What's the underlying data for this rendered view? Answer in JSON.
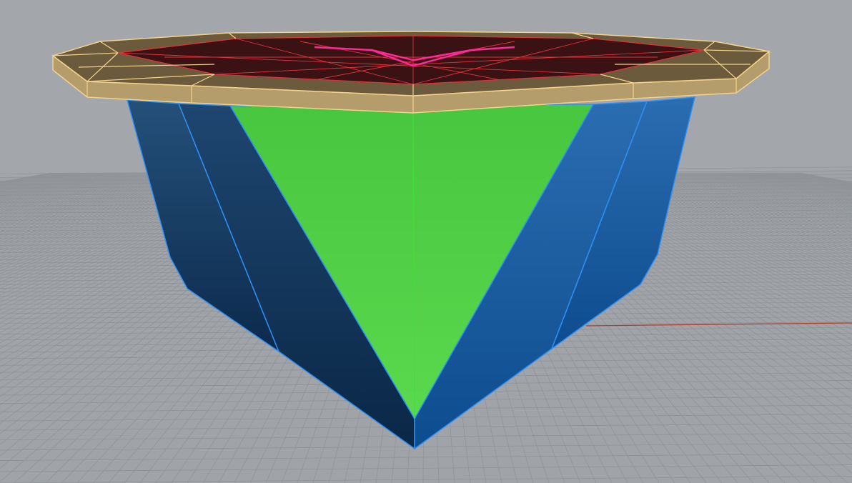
{
  "viewport": {
    "view": "perspective",
    "background_color": "#a3a7ac",
    "grid_color": "#9c9fa3",
    "grid_line_color": "#8e9296",
    "x_axis_color": "#b03a2e",
    "model": {
      "parts": [
        {
          "name": "top-slab",
          "color": "#c8ad78",
          "edge_color": "#f3d28b",
          "selected": true
        },
        {
          "name": "recessed-top-surface",
          "color": "#3a1214",
          "edge_color": "#e0323c",
          "highlight_color": "#ff2a9a"
        },
        {
          "name": "front-triangle-face",
          "color": "#52cc4a",
          "edge_color": "#3ee03e"
        },
        {
          "name": "left-faces",
          "color": "#173a62",
          "edge_color": "#2e8ff5"
        },
        {
          "name": "right-faces",
          "color": "#1a5fa2",
          "edge_color": "#2e8ff5"
        }
      ]
    }
  }
}
